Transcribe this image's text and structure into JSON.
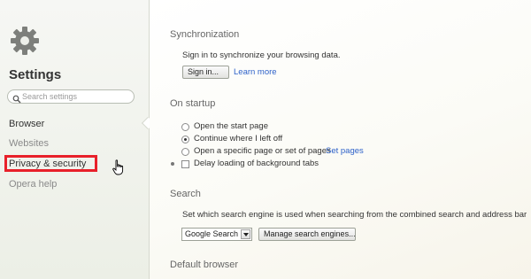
{
  "sidebar": {
    "title": "Settings",
    "search_placeholder": "Search settings",
    "items": [
      {
        "label": "Browser"
      },
      {
        "label": "Websites"
      },
      {
        "label": "Privacy & security"
      },
      {
        "label": "Opera help"
      }
    ]
  },
  "sync": {
    "title": "Synchronization",
    "description": "Sign in to synchronize your browsing data.",
    "sign_in_label": "Sign in...",
    "learn_more_label": "Learn more"
  },
  "startup": {
    "title": "On startup",
    "options": [
      {
        "label": "Open the start page",
        "selected": false
      },
      {
        "label": "Continue where I left off",
        "selected": true
      },
      {
        "label": "Open a specific page or set of pages",
        "selected": false
      }
    ],
    "set_pages_label": "Set pages",
    "delay_label": "Delay loading of background tabs",
    "delay_checked": false
  },
  "search": {
    "title": "Search",
    "description": "Set which search engine is used when searching from the combined search and address bar",
    "engine_value": "Google Search",
    "manage_label": "Manage search engines..."
  },
  "default_browser": {
    "title": "Default browser"
  },
  "colors": {
    "highlight": "#e8202a",
    "link": "#2e62c9"
  }
}
